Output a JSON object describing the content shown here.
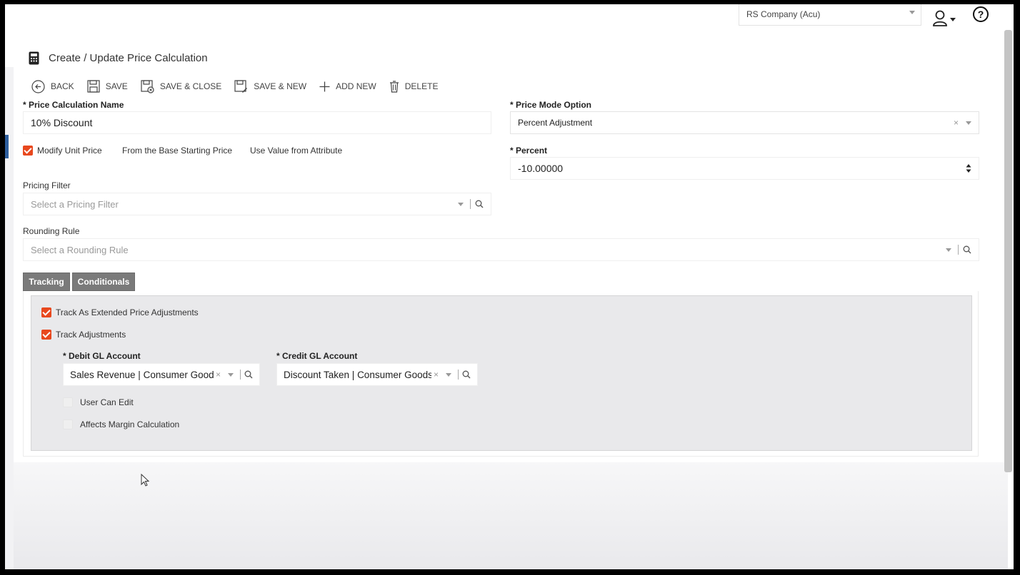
{
  "header": {
    "company": "RS Company (Acu)",
    "help_glyph": "?"
  },
  "page": {
    "title": "Create / Update Price Calculation"
  },
  "toolbar": {
    "back": "BACK",
    "save": "SAVE",
    "save_close": "SAVE & CLOSE",
    "save_new": "SAVE & NEW",
    "add_new": "ADD NEW",
    "delete": "DELETE"
  },
  "form": {
    "price_calc_name_label": "* Price Calculation Name",
    "price_calc_name_value": "10% Discount",
    "price_mode_label": "* Price Mode Option",
    "price_mode_value": "Percent Adjustment",
    "modify_unit_price": "Modify Unit Price",
    "modify_unit_price_checked": true,
    "from_base_price": "From the Base Starting Price",
    "use_value_attribute": "Use Value from Attribute",
    "percent_label": "* Percent",
    "percent_value": "-10.00000",
    "pricing_filter_label": "Pricing Filter",
    "pricing_filter_placeholder": "Select a Pricing Filter",
    "rounding_rule_label": "Rounding Rule",
    "rounding_rule_placeholder": "Select a Rounding Rule"
  },
  "tabs": [
    {
      "label": "Tracking"
    },
    {
      "label": "Conditionals"
    }
  ],
  "tracking": {
    "track_extended": "Track As Extended Price Adjustments",
    "track_extended_checked": true,
    "track_adjustments": "Track Adjustments",
    "track_adjustments_checked": true,
    "debit_label": "* Debit GL Account",
    "debit_value": "Sales Revenue | Consumer Goods",
    "credit_label": "* Credit GL Account",
    "credit_value": "Discount Taken | Consumer Goods",
    "user_can_edit": "User Can Edit",
    "user_can_edit_checked": false,
    "affects_margin": "Affects Margin Calculation",
    "affects_margin_checked": false
  },
  "colors": {
    "accent_checkbox": "#e8481e",
    "tab_bg": "#7a7a7a",
    "panel_bg": "#e9e9eb"
  }
}
